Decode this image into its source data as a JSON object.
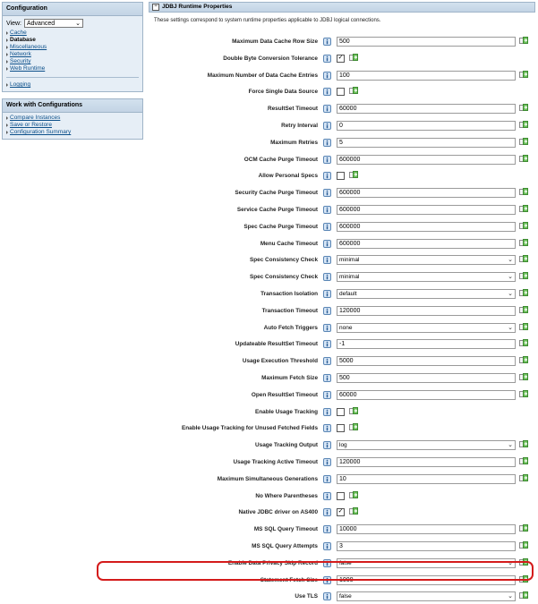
{
  "sidebar": {
    "config_title": "Configuration",
    "view_label": "View:",
    "view_value": "Advanced",
    "nav": [
      {
        "label": "Cache",
        "current": false
      },
      {
        "label": "Database",
        "current": true
      },
      {
        "label": "Miscellaneous",
        "current": false
      },
      {
        "label": "Network",
        "current": false
      },
      {
        "label": "Security",
        "current": false
      },
      {
        "label": "Web Runtime",
        "current": false
      }
    ],
    "logging_label": "Logging",
    "work_title": "Work with Configurations",
    "work_links": [
      "Compare Instances",
      "Save or Restore",
      "Configuration Summary"
    ]
  },
  "main": {
    "section_title": "JDBJ Runtime Properties",
    "collapse_symbol": "−",
    "description": "These settings correspond to system runtime properties applicable to JDBJ logical connections.",
    "highlighted_property": "Statement Fetch Size",
    "properties": [
      {
        "label": "Maximum Data Cache Row Size",
        "type": "text",
        "value": "500"
      },
      {
        "label": "Double Byte Conversion Tolerance",
        "type": "checkbox",
        "checked": true
      },
      {
        "label": "Maximum Number of Data Cache Entries",
        "type": "text",
        "value": "100"
      },
      {
        "label": "Force Single Data Source",
        "type": "checkbox",
        "checked": false
      },
      {
        "label": "ResultSet Timeout",
        "type": "text",
        "value": "60000"
      },
      {
        "label": "Retry Interval",
        "type": "text",
        "value": "0"
      },
      {
        "label": "Maximum Retries",
        "type": "text",
        "value": "5"
      },
      {
        "label": "OCM Cache Purge Timeout",
        "type": "text",
        "value": "600000"
      },
      {
        "label": "Allow Personal Specs",
        "type": "checkbox",
        "checked": false
      },
      {
        "label": "Security Cache Purge Timeout",
        "type": "text",
        "value": "600000"
      },
      {
        "label": "Service Cache Purge Timeout",
        "type": "text",
        "value": "600000"
      },
      {
        "label": "Spec Cache Purge Timeout",
        "type": "text",
        "value": "600000"
      },
      {
        "label": "Menu Cache Timeout",
        "type": "text",
        "value": "600000"
      },
      {
        "label": "Spec Consistency Check",
        "type": "select",
        "value": "minimal"
      },
      {
        "label": "Spec Consistency Check",
        "type": "select",
        "value": "minimal"
      },
      {
        "label": "Transaction Isolation",
        "type": "select",
        "value": "default"
      },
      {
        "label": "Transaction Timeout",
        "type": "text",
        "value": "120000"
      },
      {
        "label": "Auto Fetch Triggers",
        "type": "select",
        "value": "none"
      },
      {
        "label": "Updateable ResultSet Timeout",
        "type": "text",
        "value": "-1"
      },
      {
        "label": "Usage Execution Threshold",
        "type": "text",
        "value": "5000"
      },
      {
        "label": "Maximum Fetch Size",
        "type": "text",
        "value": "500"
      },
      {
        "label": "Open ResultSet Timeout",
        "type": "text",
        "value": "60000"
      },
      {
        "label": "Enable Usage Tracking",
        "type": "checkbox",
        "checked": false
      },
      {
        "label": "Enable Usage Tracking for Unused Fetched Fields",
        "type": "checkbox",
        "checked": false
      },
      {
        "label": "Usage Tracking Output",
        "type": "select",
        "value": "log"
      },
      {
        "label": "Usage Tracking Active Timeout",
        "type": "text",
        "value": "120000"
      },
      {
        "label": "Maximum Simultaneous Generations",
        "type": "text",
        "value": "10"
      },
      {
        "label": "No Where Parentheses",
        "type": "checkbox",
        "checked": false
      },
      {
        "label": "Native JDBC driver on AS400",
        "type": "checkbox",
        "checked": true
      },
      {
        "label": "MS SQL Query Timeout",
        "type": "text",
        "value": "10000"
      },
      {
        "label": "MS SQL Query Attempts",
        "type": "text",
        "value": "3"
      },
      {
        "label": "Enable Data Privacy Skip Record",
        "type": "select",
        "value": "false"
      },
      {
        "label": "Statement Fetch Size",
        "type": "text",
        "value": "1000"
      },
      {
        "label": "Use TLS",
        "type": "select",
        "value": "false"
      }
    ]
  },
  "colors": {
    "highlight": "#d41b1b",
    "panel_header": "#c3d4e5",
    "link": "#0b4f8a"
  },
  "icons": {
    "help": "help-info-icon",
    "revert": "revert-default-icon",
    "chevron": "chevron-down-icon"
  }
}
